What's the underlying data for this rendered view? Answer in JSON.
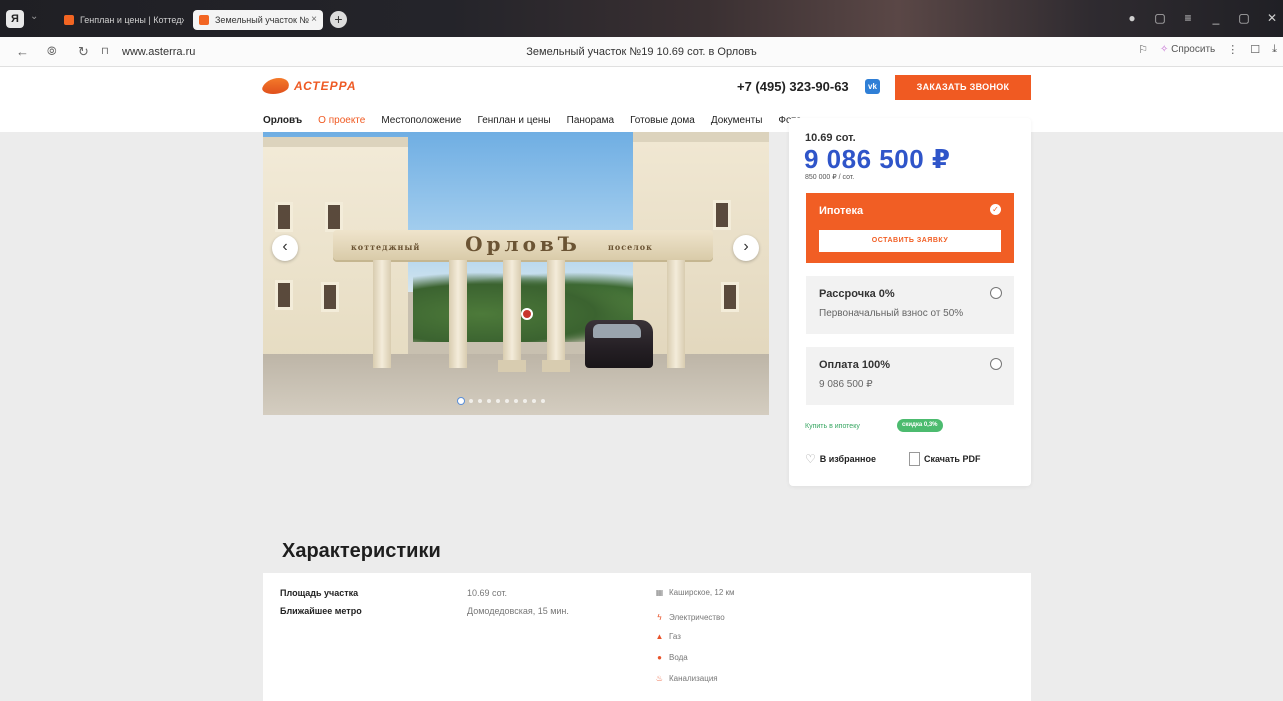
{
  "browser": {
    "menu_label": "Я",
    "tabs": [
      {
        "label": "Генплан и цены | Коттедж"
      },
      {
        "label": "Земельный участок №",
        "close": "×"
      }
    ],
    "add_tab": "+",
    "window_controls": [
      "●",
      "▢",
      "≡",
      "_",
      "▢",
      "✕"
    ],
    "url": "www.asterra.ru",
    "page_title": "Земельный участок №19 10.69 сот. в Орловъ",
    "ask_label": "Спросить",
    "nav_icons": {
      "back": "←",
      "shield": "⦾",
      "reload": "↻",
      "lock": "🔒",
      "bookmark": "⚐",
      "read": "☐",
      "download": "⤓"
    }
  },
  "site": {
    "logo_text": "АСТЕРРА",
    "phone": "+7 (495) 323-90-63",
    "vk_label": "vk",
    "call_button": "ЗАКАЗАТЬ ЗВОНОК",
    "nav": [
      "Орловъ",
      "О проекте",
      "Местоположение",
      "Генплан и цены",
      "Панорама",
      "Готовые дома",
      "Документы",
      "Фото"
    ]
  },
  "gallery": {
    "arch_text": "ОрловЪ",
    "arch_left": "коттеджный",
    "arch_right": "поселок",
    "prev": "‹",
    "next": "›",
    "slide_count": 10,
    "active_slide": 1
  },
  "card": {
    "area": "10.69 сот.",
    "price": "9 086 500 ₽",
    "price_per": "850 000 ₽ / сот.",
    "mortgage": {
      "title": "Ипотека",
      "check": "✓",
      "button": "ОСТАВИТЬ ЗАЯВКУ"
    },
    "installment": {
      "title": "Рассрочка 0%",
      "subtitle": "Первоначальный взнос от 50%"
    },
    "full_payment": {
      "title": "Оплата 100%",
      "subtitle": "9 086 500 ₽"
    },
    "buy_mortgage": "Купить в ипотеку",
    "discount": "скидка 0,3%",
    "favorite": "В избранное",
    "pdf": "Скачать PDF",
    "heart_icon": "♡"
  },
  "characteristics": {
    "title": "Характеристики",
    "rows": [
      {
        "label": "Площадь участка",
        "value": "10.69 сот."
      },
      {
        "label": "Ближайшее метро",
        "value": "Домодедовская, 15 мин."
      }
    ],
    "features": [
      {
        "icon": "▦",
        "text": "Каширское, 12 км",
        "color": "#888888"
      },
      {
        "icon": "ϟ",
        "text": "Электричество",
        "color": "#e8532a"
      },
      {
        "icon": "▲",
        "text": "Газ",
        "color": "#e8532a"
      },
      {
        "icon": "●",
        "text": "Вода",
        "color": "#e8532a"
      },
      {
        "icon": "♨",
        "text": "Канализация",
        "color": "#e8532a"
      }
    ]
  },
  "colors": {
    "accent": "#f05a22",
    "price_blue": "#2f55c9",
    "green": "#36a661"
  }
}
